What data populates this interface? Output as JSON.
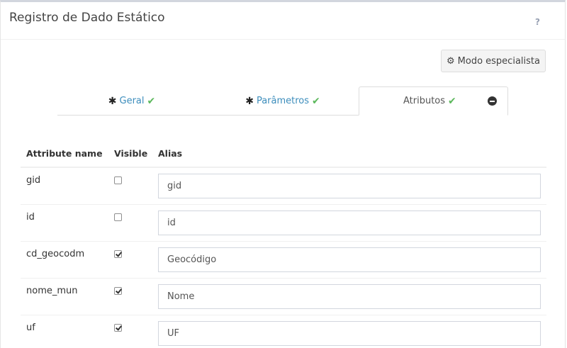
{
  "panel": {
    "title": "Registro de Dado Estático",
    "help": "?"
  },
  "toolbar": {
    "expert_label": "Modo especialista"
  },
  "tabs": [
    {
      "label": "Geral",
      "active": false
    },
    {
      "label": "Parâmetros",
      "active": false
    },
    {
      "label": "Atributos",
      "active": true
    }
  ],
  "table": {
    "headers": [
      "Attribute name",
      "Visible",
      "Alias"
    ],
    "rows": [
      {
        "name": "gid",
        "visible": false,
        "alias": "gid"
      },
      {
        "name": "id",
        "visible": false,
        "alias": "id"
      },
      {
        "name": "cd_geocodm",
        "visible": true,
        "alias": "Geocódigo"
      },
      {
        "name": "nome_mun",
        "visible": true,
        "alias": "Nome"
      },
      {
        "name": "uf",
        "visible": true,
        "alias": "UF"
      }
    ]
  },
  "colors": {
    "link": "#3c8dbc",
    "check": "#5cb85c"
  }
}
